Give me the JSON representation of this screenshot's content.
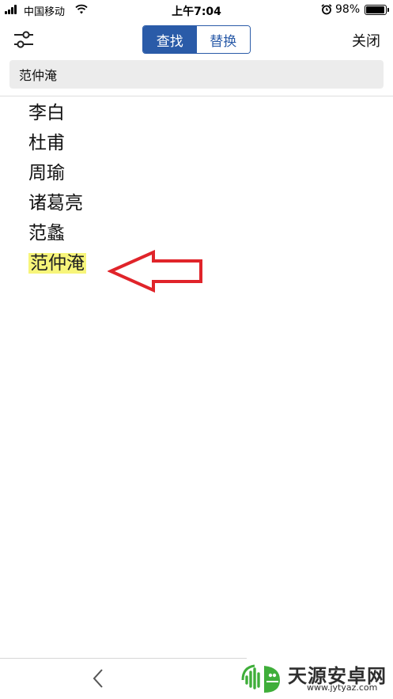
{
  "status_bar": {
    "carrier": "中国移动",
    "time": "上午7:04",
    "battery_percent": "98%",
    "battery_level": 0.98,
    "icons": [
      "signal-icon",
      "wifi-icon",
      "alarm-icon",
      "battery-icon"
    ]
  },
  "toolbar": {
    "settings_icon": "sliders-icon",
    "tabs": [
      {
        "label": "查找",
        "active": true
      },
      {
        "label": "替换",
        "active": false
      }
    ],
    "close_label": "关闭"
  },
  "search": {
    "value": "范仲淹"
  },
  "document": {
    "lines": [
      "李白",
      "杜甫",
      "周瑜",
      "诸葛亮",
      "范蠡",
      "范仲淹"
    ],
    "highlighted_line": "范仲淹"
  },
  "bottom_bar": {
    "back_icon": "chevron-left-icon"
  },
  "watermark": {
    "name": "天源安卓网",
    "url": "www.jytyaz.com"
  },
  "colors": {
    "accent": "#2a5ba8",
    "highlight": "#f7f57a",
    "annotation_arrow": "#e0242a",
    "watermark_green": "#3fae3a"
  }
}
